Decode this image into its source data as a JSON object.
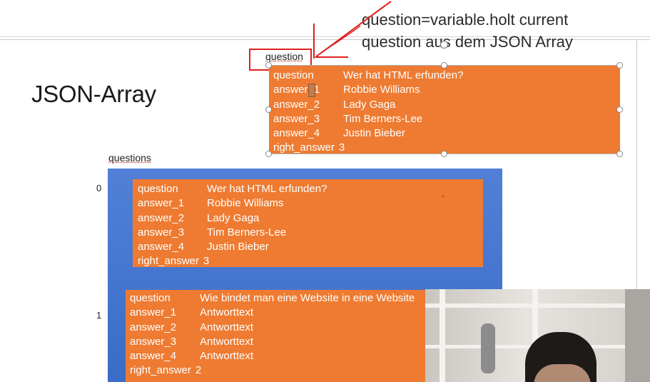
{
  "annotation": {
    "line1": "question=variable.holt current",
    "line2": "question aus dem JSON Array"
  },
  "slide": {
    "title": "JSON-Array",
    "question_var": "question",
    "questions_var": "questions",
    "index_0": "0",
    "index_1": "1"
  },
  "current_question": [
    {
      "key": "question",
      "value": "Wer hat HTML erfunden?"
    },
    {
      "key": "answer_1",
      "value": "Robbie Williams"
    },
    {
      "key": "answer_2",
      "value": "Lady Gaga"
    },
    {
      "key": "answer_3",
      "value": "Tim Berners-Lee"
    },
    {
      "key": "answer_4",
      "value": "Justin Bieber"
    },
    {
      "key": "right_answer",
      "value": "3"
    }
  ],
  "questions": [
    [
      {
        "key": "question",
        "value": "Wer hat HTML erfunden?"
      },
      {
        "key": "answer_1",
        "value": "Robbie Williams"
      },
      {
        "key": "answer_2",
        "value": "Lady Gaga"
      },
      {
        "key": "answer_3",
        "value": "Tim Berners-Lee"
      },
      {
        "key": "answer_4",
        "value": "Justin Bieber"
      },
      {
        "key": "right_answer",
        "value": "3"
      }
    ],
    [
      {
        "key": "question",
        "value": "Wie bindet man eine Website in eine Website"
      },
      {
        "key": "answer_1",
        "value": "Antworttext"
      },
      {
        "key": "answer_2",
        "value": "Antworttext"
      },
      {
        "key": "answer_3",
        "value": "Antworttext"
      },
      {
        "key": "answer_4",
        "value": "Antworttext"
      },
      {
        "key": "right_answer",
        "value": "2"
      }
    ]
  ],
  "colors": {
    "orange": "#ee7b31",
    "blue": "#3a6cc8",
    "annotation_red": "#e02020"
  }
}
